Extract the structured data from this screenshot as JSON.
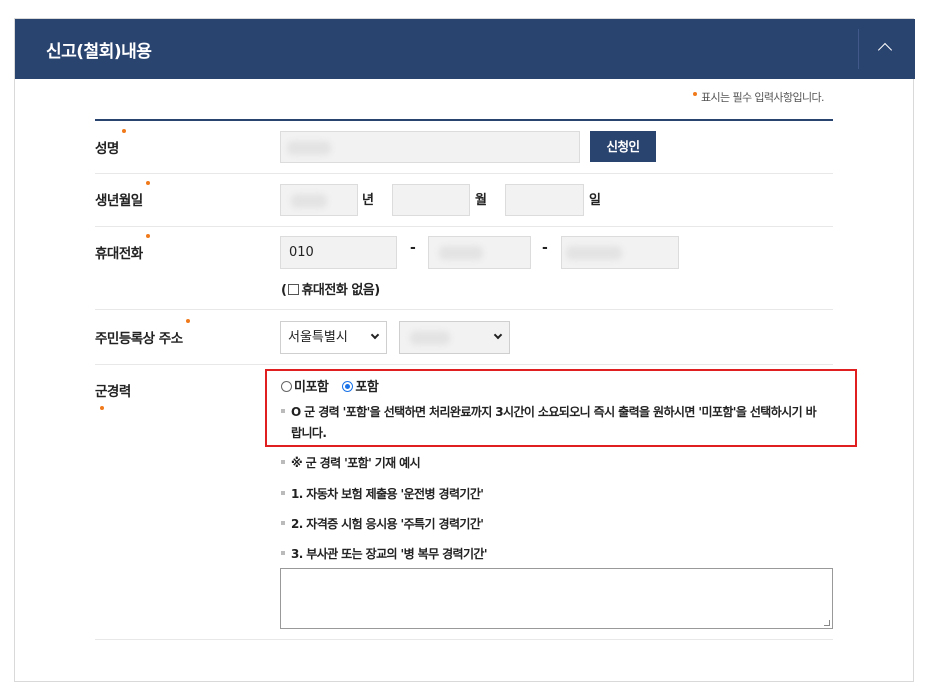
{
  "header": {
    "title": "신고(철회)내용"
  },
  "required_note": "표시는 필수 입력사항입니다.",
  "colors": {
    "header_bg": "#2a4470",
    "required_dot": "#f07a1b",
    "highlight_border": "#e02020",
    "radio_accent": "#1a73e8"
  },
  "fields": {
    "name": {
      "label": "성명",
      "button": "신청인"
    },
    "birth": {
      "label": "생년월일",
      "year_unit": "년",
      "month_unit": "월",
      "day_unit": "일"
    },
    "phone": {
      "label": "휴대전화",
      "prefix": "010",
      "separator": "-",
      "no_phone_prefix": "(",
      "no_phone_label": "휴대전화 없음)"
    },
    "address": {
      "label": "주민등록상 주소",
      "city_selected": "서울특별시"
    },
    "military": {
      "label": "군경력",
      "options": [
        {
          "label": "미포함",
          "selected": false
        },
        {
          "label": "포함",
          "selected": true
        }
      ],
      "notice_line1": "O 군 경력 '포함'을 선택하면 처리완료까지 3시간이 소요되오니 즉시 출력을 원하시면 '미포함'을 선택하시기 바",
      "notice_line2": "랍니다.",
      "example_title": "※ 군 경력 '포함' 기재 예시",
      "examples": [
        "1. 자동차 보험 제출용 '운전병 경력기간'",
        "2. 자격증 시험 응시용 '주특기 경력기간'",
        "3. 부사관 또는 장교의 '병 복무 경력기간'"
      ]
    }
  }
}
